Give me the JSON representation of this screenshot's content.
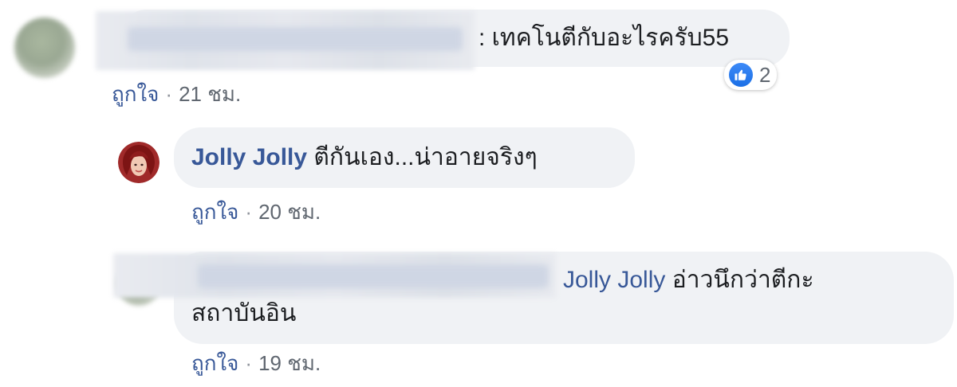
{
  "comments": [
    {
      "author_blurred": true,
      "text": ": เทคโนตีกับอะไรครับ55",
      "meta": {
        "like_label": "ถูกใจ",
        "separator": "·",
        "time": "21 ชม."
      },
      "reaction": {
        "icon": "like-icon",
        "count": "2"
      }
    },
    {
      "author": "Jolly Jolly",
      "text": "ตีกันเอง...น่าอายจริงๆ",
      "meta": {
        "like_label": "ถูกใจ",
        "separator": "·",
        "time": "20 ชม."
      }
    },
    {
      "author_blurred": true,
      "mention": "Jolly Jolly",
      "text_line1": "อ่าวนึกว่าตีกะ",
      "text_line2": "สถาบันอิน",
      "meta": {
        "like_label": "ถูกใจ",
        "separator": "·",
        "time": "19 ชม."
      }
    }
  ],
  "colors": {
    "bubble": "#f0f2f5",
    "link": "#385898",
    "meta": "#606770",
    "like_blue": "#1b6fe6"
  }
}
